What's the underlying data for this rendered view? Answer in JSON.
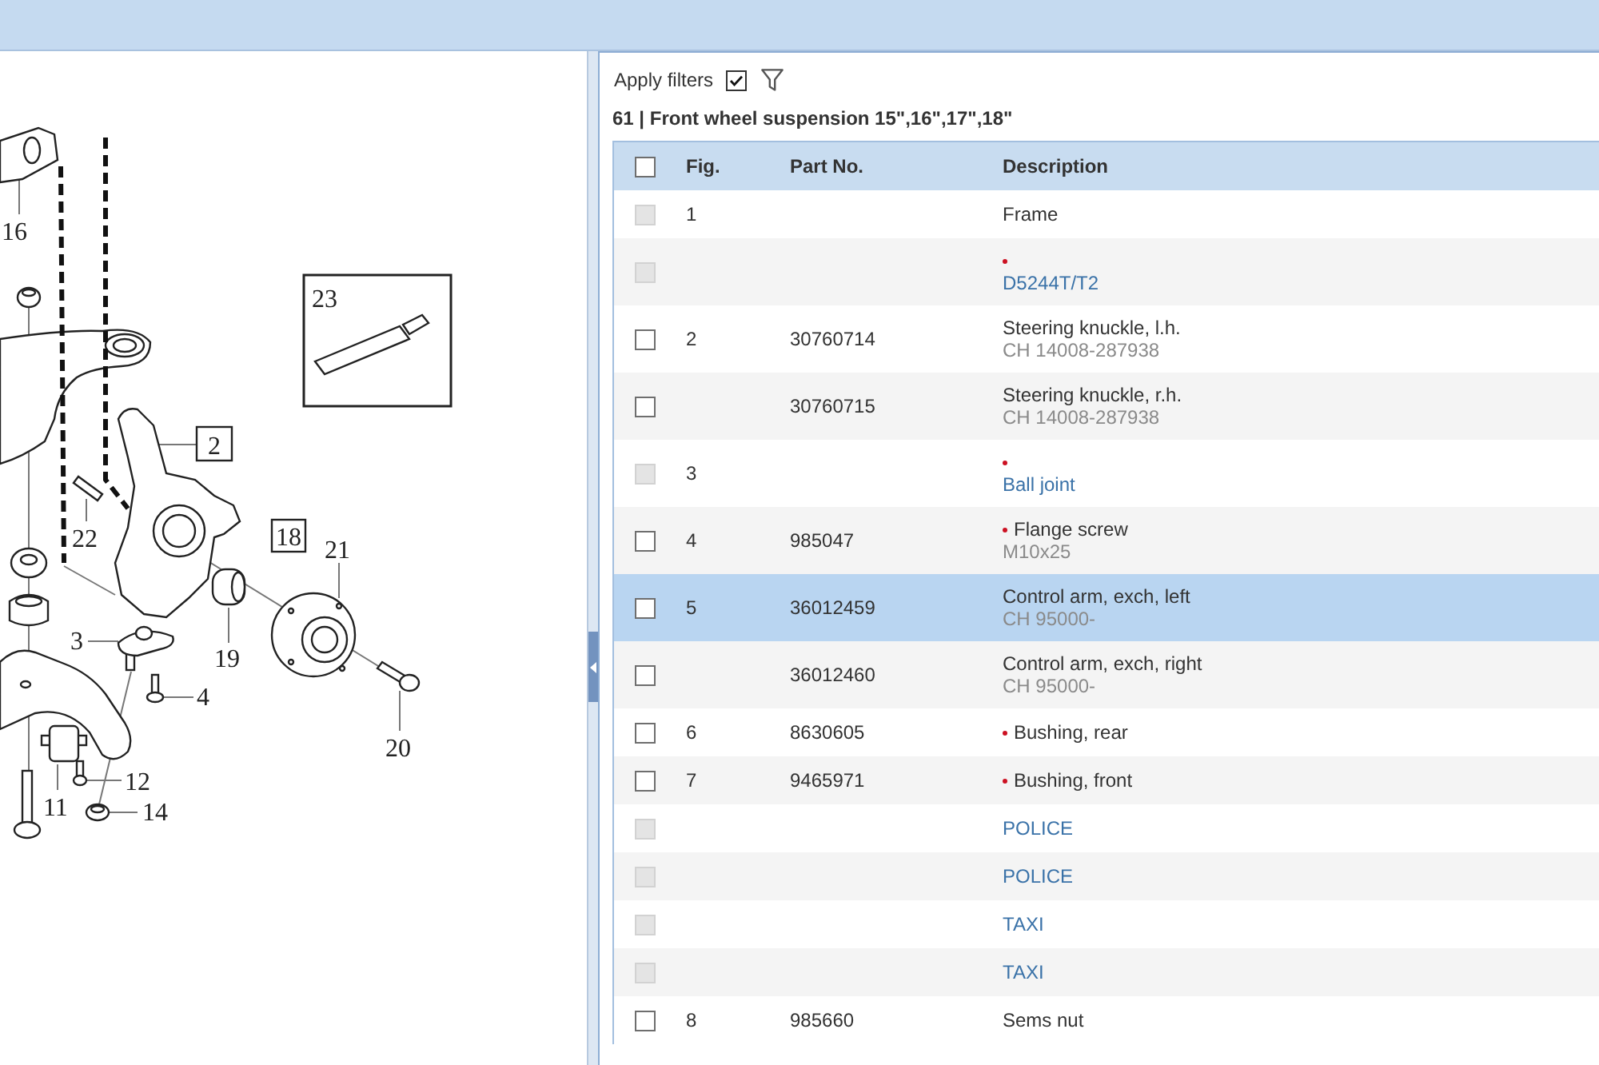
{
  "diagram": {
    "callouts": [
      {
        "label": "16",
        "kind": "plain"
      },
      {
        "label": "23",
        "kind": "inset"
      },
      {
        "label": "2",
        "kind": "boxed"
      },
      {
        "label": "22",
        "kind": "plain"
      },
      {
        "label": "18",
        "kind": "boxed"
      },
      {
        "label": "21",
        "kind": "plain"
      },
      {
        "label": "3",
        "kind": "plain"
      },
      {
        "label": "19",
        "kind": "plain"
      },
      {
        "label": "4",
        "kind": "plain"
      },
      {
        "label": "20",
        "kind": "plain"
      },
      {
        "label": "12",
        "kind": "plain"
      },
      {
        "label": "11",
        "kind": "plain"
      },
      {
        "label": "14",
        "kind": "plain"
      }
    ]
  },
  "filters": {
    "label": "Apply filters",
    "checked": true
  },
  "heading": "61 | Front wheel suspension 15\",16\",17\",18\"",
  "table": {
    "select_all": {
      "checked": false
    },
    "columns": [
      "Fig.",
      "Part No.",
      "Description"
    ],
    "rows": [
      {
        "fig": "1",
        "description": "Frame",
        "flagged": false,
        "disabled": true,
        "checked": false,
        "selected": false
      },
      {
        "link": "D5244T/T2",
        "flagged": true,
        "disabled": true,
        "checked": false,
        "selected": false
      },
      {
        "fig": "2",
        "part_no": "30760714",
        "description": "Steering knuckle, l.h.",
        "note": "CH 14008-287938",
        "flagged": false,
        "disabled": false,
        "checked": false,
        "selected": false
      },
      {
        "part_no": "30760715",
        "description": "Steering knuckle, r.h.",
        "note": "CH 14008-287938",
        "flagged": false,
        "disabled": false,
        "checked": false,
        "selected": false
      },
      {
        "fig": "3",
        "link": "Ball joint",
        "flagged": true,
        "disabled": true,
        "checked": false,
        "selected": false
      },
      {
        "fig": "4",
        "part_no": "985047",
        "description": "Flange screw",
        "note": "M10x25",
        "flagged": true,
        "disabled": false,
        "checked": false,
        "selected": false
      },
      {
        "fig": "5",
        "part_no": "36012459",
        "description": "Control arm, exch, left",
        "note": "CH 95000-",
        "flagged": false,
        "disabled": false,
        "checked": false,
        "selected": true
      },
      {
        "part_no": "36012460",
        "description": "Control arm, exch, right",
        "note": "CH 95000-",
        "flagged": false,
        "disabled": false,
        "checked": false,
        "selected": false
      },
      {
        "fig": "6",
        "part_no": "8630605",
        "description": "Bushing, rear",
        "flagged": true,
        "disabled": false,
        "checked": false,
        "selected": false
      },
      {
        "fig": "7",
        "part_no": "9465971",
        "description": "Bushing, front",
        "flagged": true,
        "disabled": false,
        "checked": false,
        "selected": false
      },
      {
        "link": "POLICE",
        "flagged": false,
        "disabled": true,
        "checked": false,
        "selected": false
      },
      {
        "link": "POLICE",
        "flagged": false,
        "disabled": true,
        "checked": false,
        "selected": false
      },
      {
        "link": "TAXI",
        "flagged": false,
        "disabled": true,
        "checked": false,
        "selected": false
      },
      {
        "link": "TAXI",
        "flagged": false,
        "disabled": true,
        "checked": false,
        "selected": false
      },
      {
        "fig": "8",
        "part_no": "985660",
        "description": "Sems nut",
        "flagged": false,
        "disabled": false,
        "checked": false,
        "selected": false
      }
    ]
  }
}
